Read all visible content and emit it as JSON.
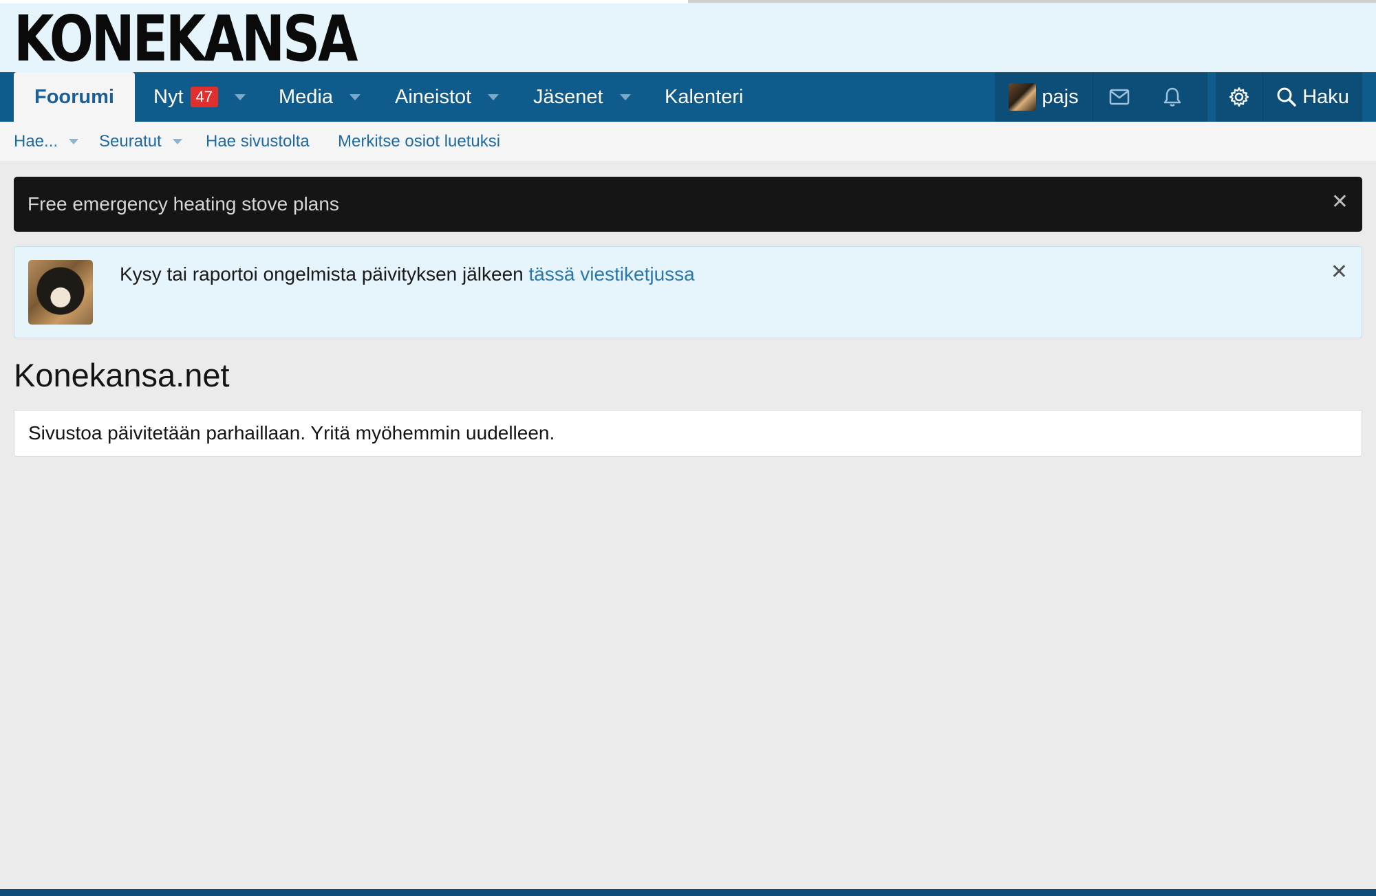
{
  "header": {
    "logo_text": "KONEKANSA"
  },
  "nav": {
    "tabs": [
      {
        "label": "Foorumi",
        "active": true
      },
      {
        "label": "Nyt",
        "badge": "47",
        "dropdown": true
      },
      {
        "label": "Media",
        "dropdown": true
      },
      {
        "label": "Aineistot",
        "dropdown": true
      },
      {
        "label": "Jäsenet",
        "dropdown": true
      },
      {
        "label": "Kalenteri"
      }
    ],
    "user": {
      "name": "pajs",
      "avatar": "user-avatar"
    },
    "icons": [
      "envelope-icon",
      "bell-icon",
      "gear-icon"
    ],
    "search_label": "Haku"
  },
  "subnav": {
    "items": [
      {
        "label": "Hae...",
        "dropdown": true
      },
      {
        "label": "Seuratut",
        "dropdown": true
      },
      {
        "label": "Hae sivustolta"
      },
      {
        "label": "Merkitse osiot luetuksi"
      }
    ]
  },
  "notices": {
    "dark": {
      "text": "Free emergency heating stove plans",
      "close": "✕"
    },
    "info": {
      "text": "Kysy tai raportoi ongelmista päivityksen jälkeen",
      "link_text": "tässä viestiketjussa",
      "close": "✕"
    }
  },
  "main": {
    "title": "Konekansa.net",
    "message": "Sivustoa päivitetään parhaillaan. Yritä myöhemmin uudelleen."
  },
  "colors": {
    "nav_bg": "#0f5b8c",
    "header_bg": "#e6f4fb",
    "link": "#1e6aa1",
    "badge": "#e02f2f",
    "page_bg": "#ebebeb"
  }
}
